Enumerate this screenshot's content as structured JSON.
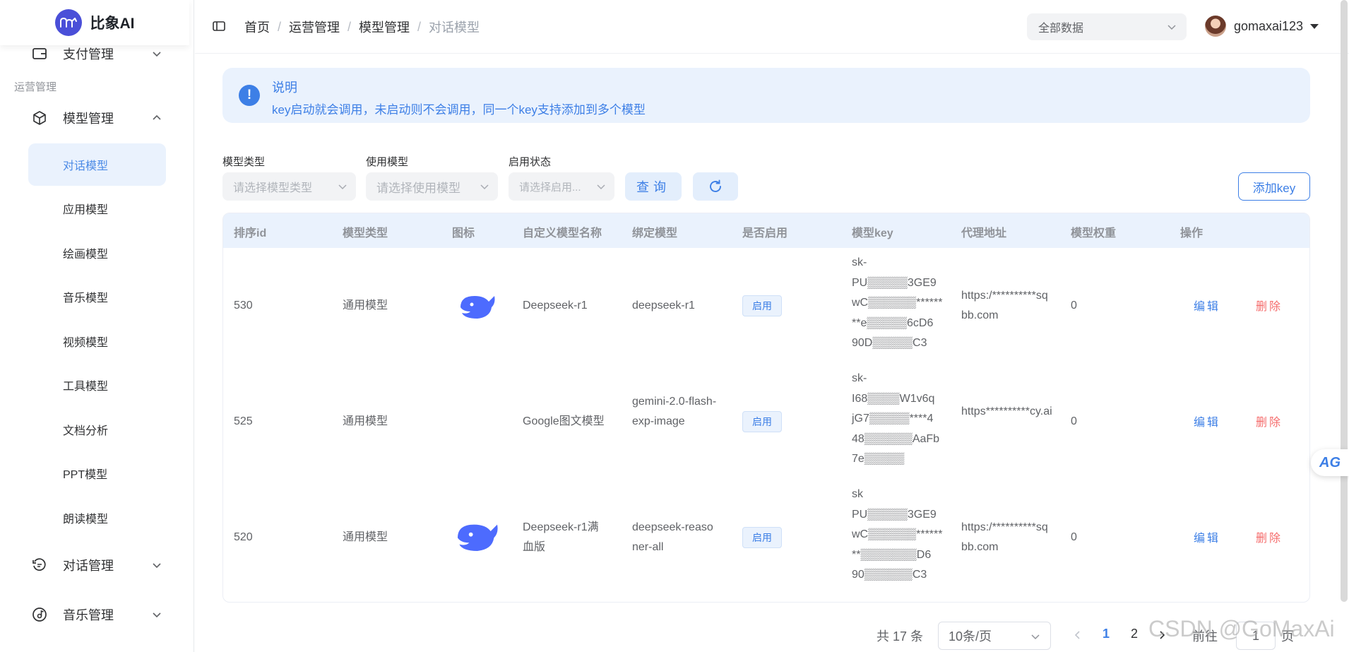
{
  "app": {
    "logo_text": "比象AI"
  },
  "sidebar": {
    "top_item": {
      "label": "支付管理",
      "icon": "wallet-icon"
    },
    "group_label": "运营管理",
    "model_menu": {
      "label": "模型管理",
      "icon": "cube-icon",
      "expanded": true
    },
    "submenu": [
      {
        "label": "对话模型",
        "active": true
      },
      {
        "label": "应用模型",
        "active": false
      },
      {
        "label": "绘画模型",
        "active": false
      },
      {
        "label": "音乐模型",
        "active": false
      },
      {
        "label": "视频模型",
        "active": false
      },
      {
        "label": "工具模型",
        "active": false
      },
      {
        "label": "文档分析",
        "active": false
      },
      {
        "label": "PPT模型",
        "active": false
      },
      {
        "label": "朗读模型",
        "active": false
      }
    ],
    "chat_menu": {
      "label": "对话管理",
      "icon": "chat-history-icon"
    },
    "music_menu": {
      "label": "音乐管理",
      "icon": "music-disc-icon"
    }
  },
  "header": {
    "breadcrumb": [
      "首页",
      "运营管理",
      "模型管理",
      "对话模型"
    ],
    "data_scope": "全部数据",
    "username": "gomaxai123"
  },
  "notice": {
    "title": "说明",
    "text": "key启动就会调用，未启动则不会调用，同一个key支持添加到多个模型"
  },
  "filters": {
    "model_type": {
      "label": "模型类型",
      "placeholder": "请选择模型类型"
    },
    "use_model": {
      "label": "使用模型",
      "placeholder": "请选择使用模型"
    },
    "status": {
      "label": "启用状态",
      "placeholder": "请选择启用..."
    },
    "query_label": "查询",
    "add_label": "添加key"
  },
  "table": {
    "columns": [
      "排序id",
      "模型类型",
      "图标",
      "自定义模型名称",
      "绑定模型",
      "是否启用",
      "模型key",
      "代理地址",
      "模型权重",
      "操作"
    ],
    "rows": [
      {
        "id": "530",
        "type": "通用模型",
        "icon": "deepseek-whale-icon",
        "name": "Deepseek-r1",
        "bound": "deepseek-r1",
        "status": "启用",
        "key_lines": [
          "sk-",
          "PU▒▒▒▒▒3GE9",
          "wC▒▒▒▒▒▒******",
          "**e▒▒▒▒▒6cD6",
          "90D▒▒▒▒▒C3"
        ],
        "proxy": "https:/**********sqbb.com",
        "weight": "0",
        "edit": "编辑",
        "delete": "删除"
      },
      {
        "id": "525",
        "type": "通用模型",
        "icon": "",
        "name": "Google图文模型",
        "bound": "gemini-2.0-flash-exp-image",
        "status": "启用",
        "key_lines": [
          "sk-",
          "I68▒▒▒▒W1v6q",
          "jG7▒▒▒▒▒****4",
          "48▒▒▒▒▒▒AaFb",
          "7e▒▒▒▒▒"
        ],
        "proxy": "https**********cy.ai",
        "weight": "0",
        "edit": "编辑",
        "delete": "删除"
      },
      {
        "id": "520",
        "type": "通用模型",
        "icon": "deepseek-whale-icon",
        "name": "Deepseek-r1满血版",
        "bound": "deepseek-reasoner-all",
        "status": "启用",
        "key_lines": [
          "sk",
          "PU▒▒▒▒▒3GE9",
          "wC▒▒▒▒▒▒******",
          "**▒▒▒▒▒▒▒D6",
          "90▒▒▒▒▒▒C3"
        ],
        "proxy": "https:/**********sqbb.com",
        "weight": "0",
        "edit": "编辑",
        "delete": "删除"
      }
    ]
  },
  "pagination": {
    "total": "共 17 条",
    "page_size": "10条/页",
    "pages": [
      "1",
      "2"
    ],
    "current_page": "1",
    "goto_label": "前往",
    "goto_value": "1",
    "page_suffix": "页"
  },
  "watermark": "CSDN @GoMaxAi",
  "float_badge": "AG",
  "colors": {
    "primary": "#3d7fe6",
    "danger": "#f56c6c",
    "active_bg": "#eaf2fd",
    "logo": "#4a4fd8"
  }
}
